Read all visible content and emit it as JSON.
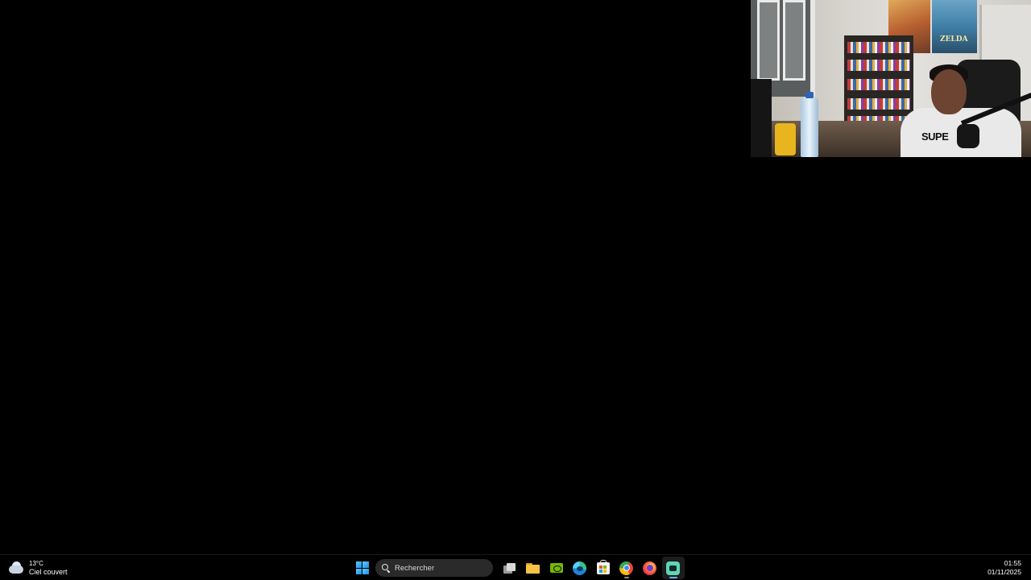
{
  "webcam": {
    "shirt_print": "SUPE",
    "poster_text": "ZELDA"
  },
  "taskbar": {
    "weather": {
      "temperature": "13°C",
      "condition": "Ciel couvert",
      "icon": "cloudy-icon"
    },
    "start": {
      "icon": "windows-start-icon"
    },
    "search": {
      "placeholder": "Rechercher",
      "icon": "search-icon"
    },
    "pinned_apps": [
      {
        "name": "Vue des tâches",
        "icon": "task-view-icon",
        "running": false
      },
      {
        "name": "Explorateur de fichiers",
        "icon": "file-explorer-icon",
        "running": false
      },
      {
        "name": "NVIDIA",
        "icon": "nvidia-icon",
        "running": false
      },
      {
        "name": "Microsoft Edge",
        "icon": "edge-icon",
        "running": false
      },
      {
        "name": "Microsoft Store",
        "icon": "store-icon",
        "running": false
      },
      {
        "name": "Google Chrome",
        "icon": "chrome-icon",
        "running": true
      },
      {
        "name": "Firefox",
        "icon": "firefox-icon",
        "running": false
      },
      {
        "name": "Application active",
        "icon": "app-icon",
        "running": true,
        "active": true
      }
    ],
    "clock": {
      "time": "01:55",
      "date": "01/11/2025"
    },
    "colors": {
      "accent": "#5fb6ff",
      "taskbar_bg": "#000000",
      "search_bg": "#2a2a2a"
    }
  }
}
